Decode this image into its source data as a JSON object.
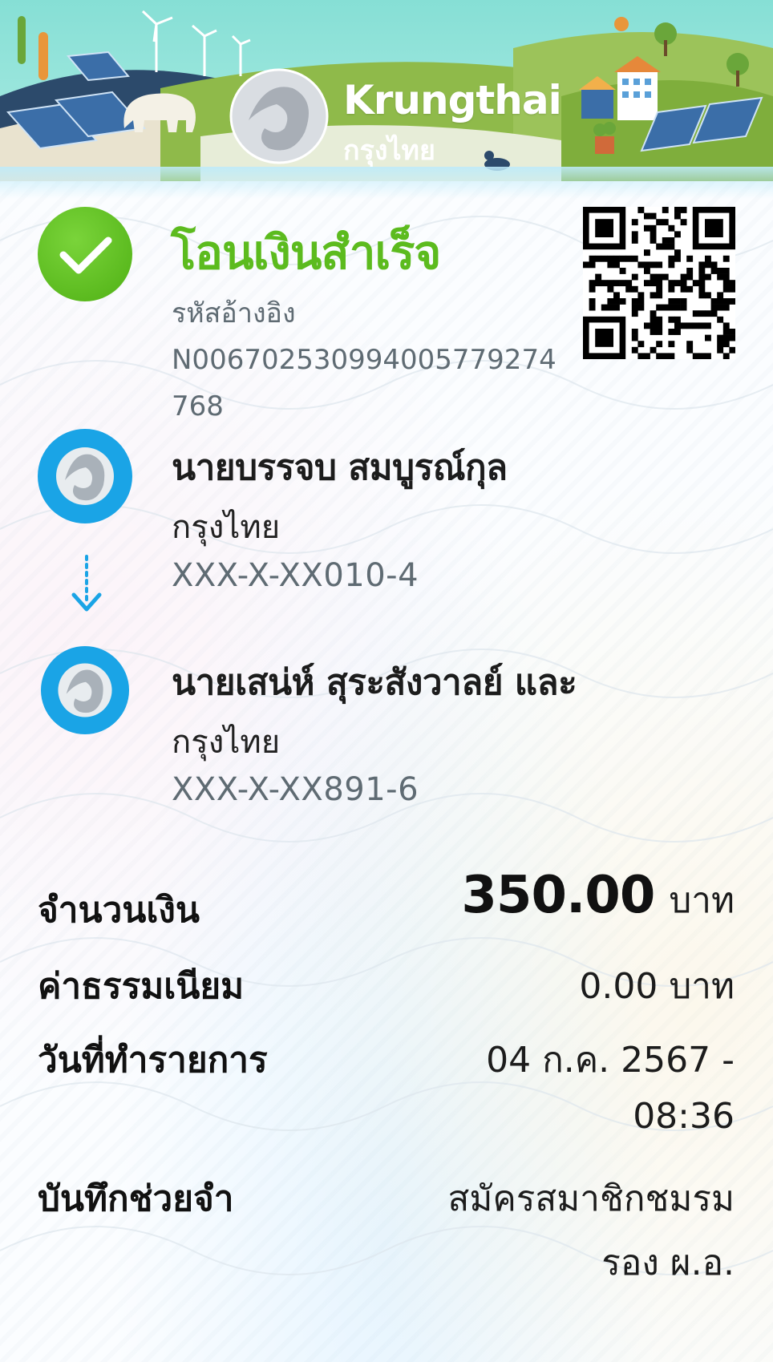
{
  "brand": {
    "name_en": "Krungthai",
    "name_th": "กรุงไทย"
  },
  "status": {
    "title": "โอนเงินสำเร็จ",
    "ref_label": "รหัสอ้างอิง",
    "ref_code": "N006702530994005779274768"
  },
  "sender": {
    "name": "นายบรรจบ สมบูรณ์กุล",
    "bank": "กรุงไทย",
    "account": "XXX-X-XX010-4"
  },
  "receiver": {
    "name": "นายเสน่ห์ สุระสังวาลย์ และ",
    "bank": "กรุงไทย",
    "account": "XXX-X-XX891-6"
  },
  "details": {
    "amount_label": "จำนวนเงิน",
    "amount_value": "350.00",
    "amount_unit": "บาท",
    "fee_label": "ค่าธรรมเนียม",
    "fee_value": "0.00 บาท",
    "date_label": "วันที่ทำรายการ",
    "date_line1": "04 ก.ค. 2567 -",
    "date_line2": "08:36",
    "memo_label": "บันทึกช่วยจำ",
    "memo_line1": "สมัครสมาชิกชมรม",
    "memo_line2": "รอง ผ.อ."
  },
  "colors": {
    "success_green": "#5cbb1e",
    "bank_blue": "#1aa4e6",
    "muted_text": "#5f6b73"
  }
}
